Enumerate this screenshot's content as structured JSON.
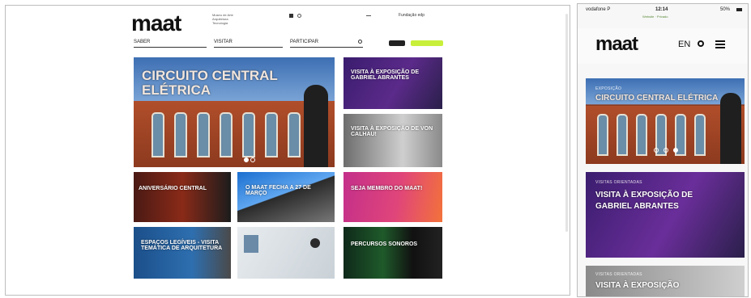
{
  "desktop": {
    "logo": "maat",
    "header_small": "Museu de Arte Arquitetura Tecnologia",
    "nav": {
      "search": "SABER",
      "visit": "VISITAR",
      "participate": "PARTICIPAR"
    },
    "right_text": "Fundação edp",
    "tiles": [
      {
        "kicker": "",
        "title": "CIRCUITO CENTRAL ELÉTRICA"
      },
      {
        "kicker": "",
        "title": "VISITA À EXPOSIÇÃO DE GABRIEL ABRANTES"
      },
      {
        "kicker": "",
        "title": "VISITA À EXPOSIÇÃO DE VON CALHAU!"
      },
      {
        "kicker": "",
        "title": "ANIVERSÁRIO CENTRAL"
      },
      {
        "kicker": "",
        "title": "O MAAT FECHA A 27 DE MARÇO"
      },
      {
        "kicker": "",
        "title": "SEJA MEMBRO DO MAAT!"
      },
      {
        "kicker": "",
        "title": "ESPAÇOS LEGÍVEIS - VISITA TEMÁTICA DE ARQUITETURA"
      },
      {
        "kicker": "",
        "title": ""
      },
      {
        "kicker": "",
        "title": "PERCURSOS SONOROS"
      }
    ],
    "colors": {
      "accent": "#c8f03a",
      "purple": "#5b2a8a",
      "blue": "#1b4f8a",
      "magenta": "#d0308a"
    }
  },
  "mobile": {
    "status": {
      "carrier": "vodafone P",
      "time": "12:14",
      "battery": "50%"
    },
    "url_hint": "Website · Privado",
    "logo": "maat",
    "lang": "EN",
    "icons": [
      "search-icon",
      "menu-icon"
    ],
    "tiles": [
      {
        "kicker": "EXPOSIÇÃO",
        "title": "CIRCUITO CENTRAL ELÉTRICA"
      },
      {
        "kicker": "VISITAS ORIENTADAS",
        "title": "VISITA À EXPOSIÇÃO DE GABRIEL ABRANTES"
      },
      {
        "kicker": "VISITAS ORIENTADAS",
        "title": "VISITA À EXPOSIÇÃO"
      }
    ]
  }
}
